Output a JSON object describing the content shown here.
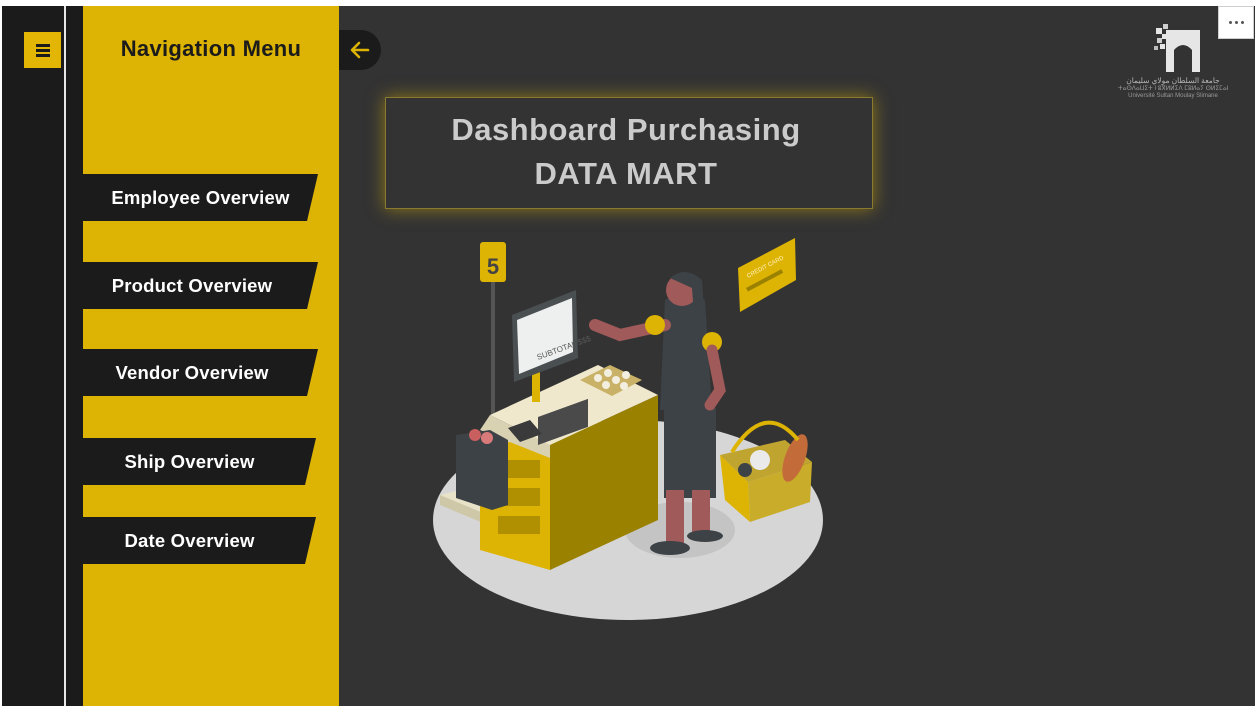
{
  "sidebar": {
    "menu_icon": "hamburger-icon",
    "title": "Navigation Menu",
    "back_icon": "arrow-left-icon",
    "items": [
      {
        "label": "Employee Overview"
      },
      {
        "label": "Product Overview"
      },
      {
        "label": "Vendor Overview"
      },
      {
        "label": "Ship Overview"
      },
      {
        "label": "Date Overview"
      }
    ]
  },
  "main": {
    "title_line1": "Dashboard Purchasing",
    "title_line2": "DATA MART",
    "more_icon": "more-options-icon"
  },
  "logo": {
    "line1": "جامعة السلطان مولاي سليمان",
    "line2": "ⵜⴰⵙⴷⴰⵡⵉⵜ ⵏ ⵓⴳⵍⵍⵉⴷ ⵎⵓⵍⴰⵢ ⵙⵍⵉⵎⴰⵏ",
    "line3": "Université Sultan Moulay Slimane"
  },
  "illustration": {
    "sign_number": "5",
    "screen_text": "SUBTOTAL $$$",
    "card_text": "CREDIT CARD"
  },
  "colors": {
    "accent": "#ddb304",
    "dark": "#1b1b1b",
    "background": "#333333",
    "title_text": "#cbcbcb"
  }
}
